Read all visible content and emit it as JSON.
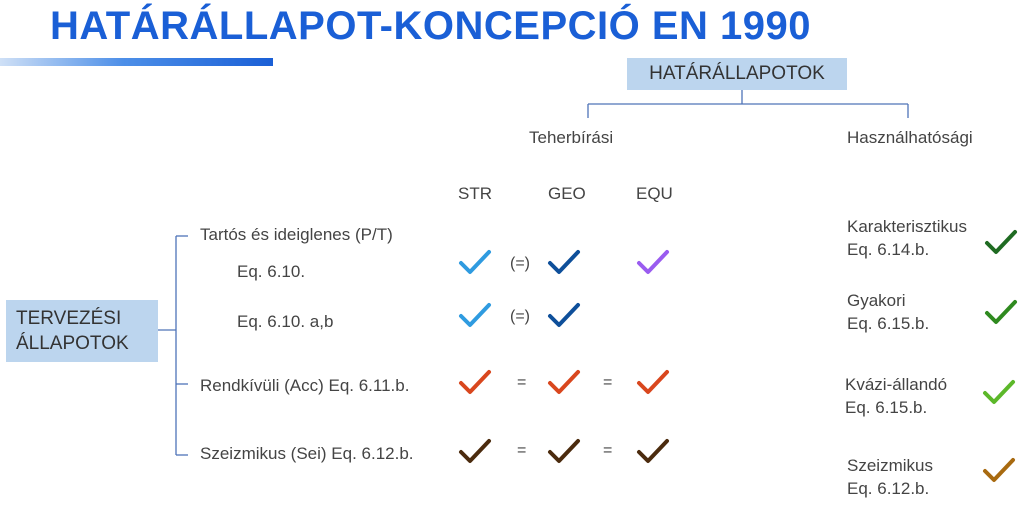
{
  "title": "HATÁRÁLLAPOT-KONCEPCIÓ EN 1990",
  "header_box": "HATÁRÁLLAPOTOK",
  "branches": {
    "left": "Teherbírási",
    "right": "Használhatósági"
  },
  "columns": [
    "STR",
    "GEO",
    "EQU"
  ],
  "design_box": {
    "line1": "TERVEZÉSI",
    "line2": "ÁLLAPOTOK"
  },
  "rows": [
    {
      "label": "Tartós és ideiglenes (P/T)",
      "sub1": "Eq. 6.10.",
      "sub2": "Eq. 6.10. a,b",
      "paren1": "(=)",
      "paren2": "(=)"
    },
    {
      "label": "Rendkívüli (Acc)  Eq. 6.11.b.",
      "sep1": "=",
      "sep2": "="
    },
    {
      "label": "Szeizmikus (Sei) Eq. 6.12.b.",
      "sep1": "=",
      "sep2": "="
    }
  ],
  "serviceability": [
    {
      "name": "Karakterisztikus",
      "eq": "Eq. 6.14.b."
    },
    {
      "name": "Gyakori",
      "eq": "Eq. 6.15.b."
    },
    {
      "name": "Kvázi-állandó",
      "eq": "Eq. 6.15.b."
    },
    {
      "name": "Szeizmikus",
      "eq": "Eq. 6.12.b."
    }
  ],
  "colors": {
    "title": "#1a5fd6",
    "box": "#bcd5ee",
    "lines": "#4f74b8",
    "check_light_blue": "#2f9be0",
    "check_dark_blue": "#0e4f9a",
    "check_purple": "#9a5cf0",
    "check_red": "#d9471e",
    "check_brown": "#4b2b0e",
    "check_green_dark": "#1f6b22",
    "check_green": "#2f8a1f",
    "check_green_light": "#5cb82a",
    "check_ochre": "#a86a10"
  }
}
